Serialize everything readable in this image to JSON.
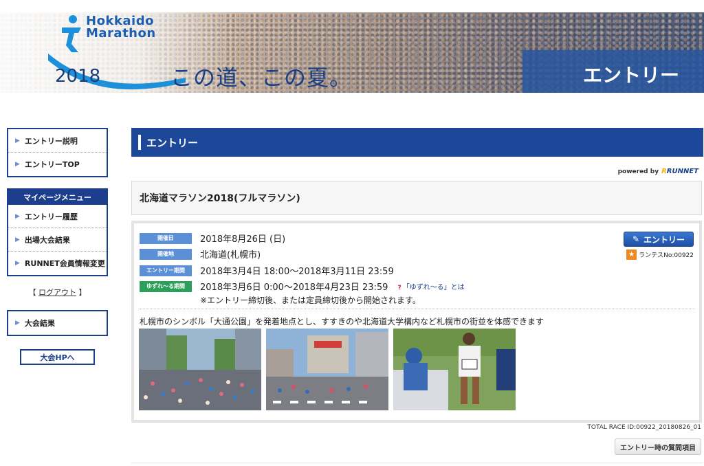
{
  "banner": {
    "logo_line1": "Hokkaido",
    "logo_line2": "Marathon",
    "logo_year": "2018",
    "catchphrase": "この道、この夏。",
    "section_title": "エントリー"
  },
  "sidebar": {
    "group1": [
      {
        "label": "エントリー説明"
      },
      {
        "label": "エントリーTOP"
      }
    ],
    "mypage_heading": "マイページメニュー",
    "group2": [
      {
        "label": "エントリー履歴"
      },
      {
        "label": "出場大会結果"
      },
      {
        "label": "RUNNET会員情報変更"
      }
    ],
    "logout_open": "【",
    "logout_label": "ログアウト",
    "logout_close": "】",
    "group3": [
      {
        "label": "大会結果"
      }
    ],
    "hp_button": "大会HPへ"
  },
  "main": {
    "page_title": "エントリー",
    "powered_by": "powered by",
    "runnet_logo": "RUNNET",
    "race_title": "北海道マラソン2018(フルマラソン)",
    "entry_button": "エントリー",
    "runtes_label": "ランテスNo:00922",
    "rows": [
      {
        "tag": "開催日",
        "value": "2018年8月26日 (日)"
      },
      {
        "tag": "開催地",
        "value": "北海道(札幌市)"
      },
      {
        "tag": "エントリー期間",
        "value": "2018年3月4日 18:00〜2018年3月11日 23:59"
      },
      {
        "tag": "ゆずれ〜る期間",
        "value": "2018年3月6日 0:00〜2018年4月23日 23:59"
      }
    ],
    "yuzure_link": "「ゆずれ〜る」とは",
    "note": "※エントリー締切後、または定員締切後から開始されます。",
    "description": "札幌市のシンボル「大通公園」を発着地点とし、すすきのや北海道大学構内など札幌市の街並を体感できます",
    "total_race_id": "TOTAL RACE ID:00922_20180826_01",
    "question_button": "エントリー時の質問項目"
  },
  "colors": {
    "navy": "#1d3e8c",
    "header_blue": "#1d4799",
    "tag_blue": "#5b8fd6",
    "tag_green": "#2aa05a",
    "runtes_orange": "#f0891f"
  }
}
